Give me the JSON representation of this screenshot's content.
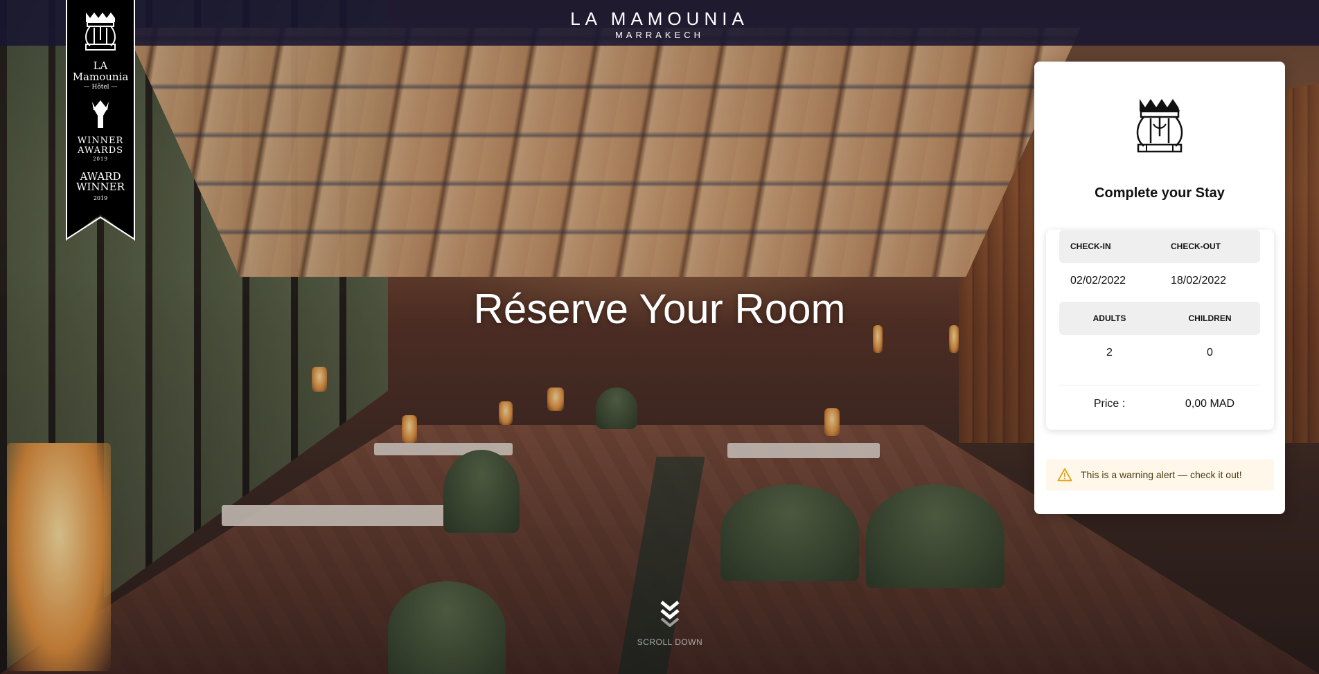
{
  "header": {
    "brand_name": "LA MAMOUNIA",
    "brand_city": "MARRAKECH"
  },
  "award_ribbon": {
    "hotel_name_line1": "LA",
    "hotel_name_line2": "Mamounia",
    "hotel_sub": "— Hôtel —",
    "winner_line1": "WINNER",
    "winner_line2": "AWARDS",
    "winner_year": "2019",
    "award_line1": "AWARD",
    "award_line2": "WINNER",
    "award_year": "2019"
  },
  "hero": {
    "title": "Réserve Your Room",
    "scroll_label": "SCROLL DOWN"
  },
  "booking": {
    "title": "Complete your Stay",
    "check_in_label": "CHECK-IN",
    "check_out_label": "CHECK-OUT",
    "check_in_value": "02/02/2022",
    "check_out_value": "18/02/2022",
    "adults_label": "ADULTS",
    "children_label": "CHILDREN",
    "adults_value": "2",
    "children_value": "0",
    "price_label": "Price :",
    "price_value": "0,00 MAD"
  },
  "alert": {
    "type": "warning",
    "icon": "warning-triangle-icon",
    "text": "This is a warning alert — check it out!",
    "color": "#e0a21a"
  },
  "colors": {
    "header_bg": "#18162f",
    "card_bg": "#ffffff",
    "alert_bg": "#fff8ea"
  }
}
